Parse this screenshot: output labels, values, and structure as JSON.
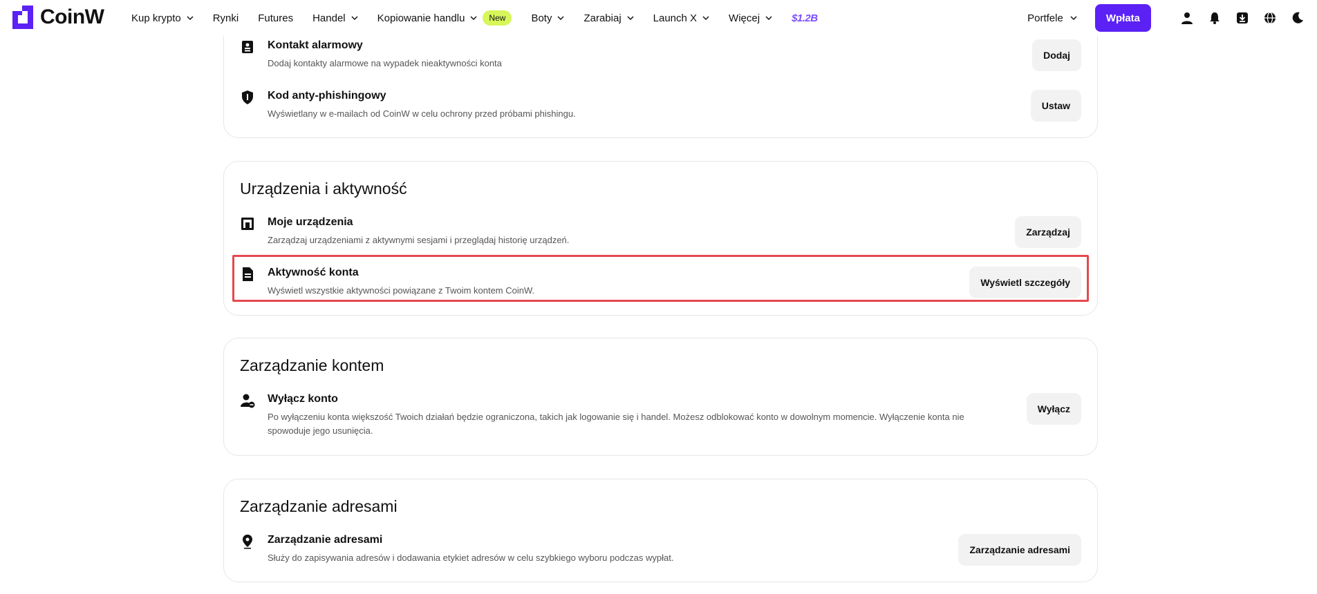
{
  "brand": {
    "name": "CoinW",
    "accent": "#5b21f5"
  },
  "nav": {
    "items": [
      {
        "label": "Kup krypto",
        "dropdown": true
      },
      {
        "label": "Rynki",
        "dropdown": false
      },
      {
        "label": "Futures",
        "dropdown": false
      },
      {
        "label": "Handel",
        "dropdown": true
      },
      {
        "label": "Kopiowanie handlu",
        "dropdown": true,
        "badge": "New"
      },
      {
        "label": "Boty",
        "dropdown": true
      },
      {
        "label": "Zarabiaj",
        "dropdown": true
      },
      {
        "label": "Launch X",
        "dropdown": true
      },
      {
        "label": "Więcej",
        "dropdown": true
      }
    ],
    "promo": "$1.2B"
  },
  "right_nav": {
    "wallets_label": "Portfele",
    "deposit_label": "Wpłata",
    "icons": [
      "user-icon",
      "bell-icon",
      "download-icon",
      "globe-icon",
      "moon-icon"
    ]
  },
  "sections": {
    "security_tail": {
      "rows": [
        {
          "icon": "contact-card-icon",
          "title": "Kontakt alarmowy",
          "desc": "Dodaj kontakty alarmowe na wypadek nieaktywności konta",
          "button": "Dodaj"
        },
        {
          "icon": "shield-icon",
          "title": "Kod anty-phishingowy",
          "desc": "Wyświetlany w e-mailach od CoinW w celu ochrony przed próbami phishingu.",
          "button": "Ustaw"
        }
      ]
    },
    "devices": {
      "title": "Urządzenia i aktywność",
      "rows": [
        {
          "icon": "devices-icon",
          "title": "Moje urządzenia",
          "desc": "Zarządzaj urządzeniami z aktywnymi sesjami i przeglądaj historię urządzeń.",
          "button": "Zarządzaj"
        },
        {
          "icon": "document-icon",
          "title": "Aktywność konta",
          "desc": "Wyświetl wszystkie aktywności powiązane z Twoim kontem CoinW.",
          "button": "Wyświetl szczegóły"
        }
      ]
    },
    "account": {
      "title": "Zarządzanie kontem",
      "rows": [
        {
          "icon": "user-disable-icon",
          "title": "Wyłącz konto",
          "desc": "Po wyłączeniu konta większość Twoich działań będzie ograniczona, takich jak logowanie się i handel. Możesz odblokować konto w dowolnym momencie. Wyłączenie konta nie spowoduje jego usunięcia.",
          "button": "Wyłącz"
        }
      ]
    },
    "addresses": {
      "title": "Zarządzanie adresami",
      "rows": [
        {
          "icon": "location-pin-icon",
          "title": "Zarządzanie adresami",
          "desc": "Służy do zapisywania adresów i dodawania etykiet adresów w celu szybkiego wyboru podczas wypłat.",
          "button": "Zarządzanie adresami"
        }
      ]
    }
  }
}
